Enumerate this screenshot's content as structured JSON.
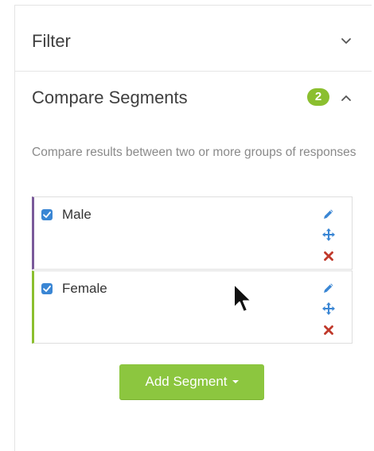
{
  "filter": {
    "title": "Filter",
    "toggle_icon": "chevron-down-icon"
  },
  "compare_segments": {
    "title": "Compare Segments",
    "count": "2",
    "toggle_icon": "chevron-up-icon",
    "description": "Compare results between two or more groups of responses",
    "segments": [
      {
        "label": "Male",
        "checked": true,
        "accent_color": "#7a5a9a"
      },
      {
        "label": "Female",
        "checked": true,
        "accent_color": "#8bbf2f"
      }
    ],
    "add_button_label": "Add Segment"
  },
  "colors": {
    "badge": "#8bbf2f",
    "button": "#8cc63f",
    "checkbox": "#3a86d4",
    "icon_blue": "#3a86d4",
    "icon_red": "#c0392b"
  }
}
